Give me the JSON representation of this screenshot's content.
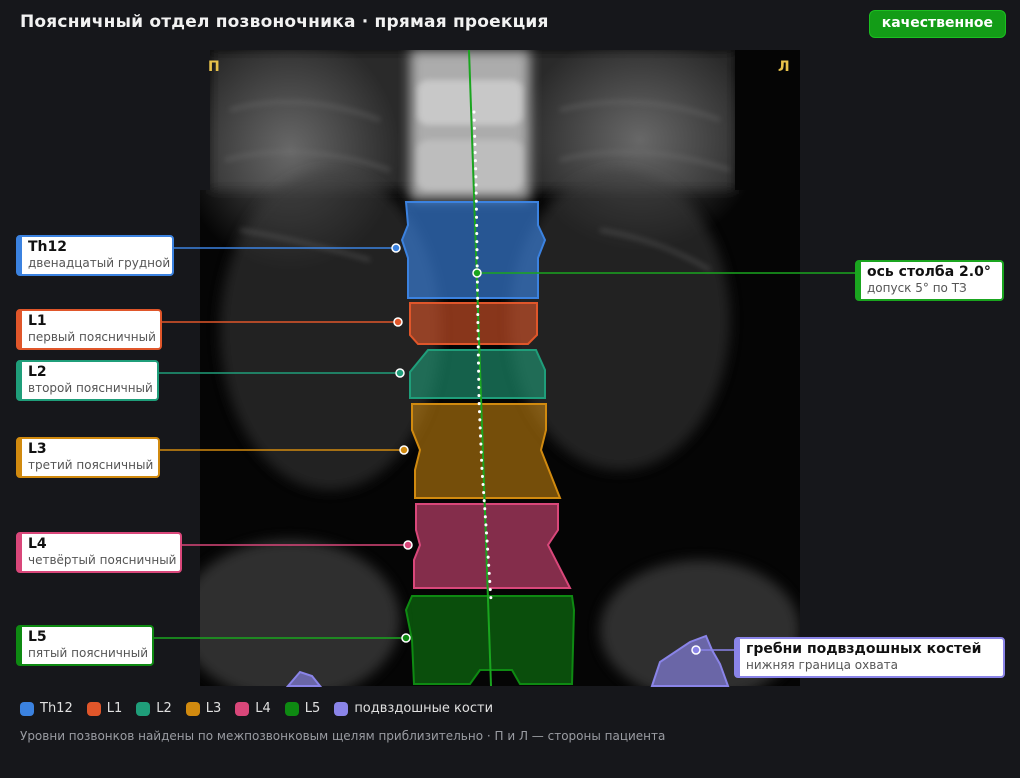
{
  "header": {
    "title": "Поясничный отдел позвоночника · прямая проекция",
    "badge": "качественное"
  },
  "image": {
    "side_left": "П",
    "side_right": "Л"
  },
  "vertebrae": [
    {
      "id": "th12",
      "name": "Th12",
      "desc": "двенадцатый грудной",
      "color": "#3b82e0"
    },
    {
      "id": "l1",
      "name": "L1",
      "desc": "первый поясничный",
      "color": "#e0562a"
    },
    {
      "id": "l2",
      "name": "L2",
      "desc": "второй поясничный",
      "color": "#1f9e7a"
    },
    {
      "id": "l3",
      "name": "L3",
      "desc": "третий поясничный",
      "color": "#d18a0f"
    },
    {
      "id": "l4",
      "name": "L4",
      "desc": "четвёртый поясничный",
      "color": "#d9477a"
    },
    {
      "id": "l5",
      "name": "L5",
      "desc": "пятый поясничный",
      "color": "#0e8a12"
    }
  ],
  "axis": {
    "title": "ось столба 2.0°",
    "note": "допуск 5° по ТЗ",
    "color": "#1aa51f"
  },
  "iliac": {
    "title": "гребни подвздошных костей",
    "note": "нижняя граница охвата",
    "color": "#8a84e8"
  },
  "legend": [
    {
      "label": "Th12",
      "color": "#3b82e0"
    },
    {
      "label": "L1",
      "color": "#e0562a"
    },
    {
      "label": "L2",
      "color": "#1f9e7a"
    },
    {
      "label": "L3",
      "color": "#d18a0f"
    },
    {
      "label": "L4",
      "color": "#d9477a"
    },
    {
      "label": "L5",
      "color": "#0e8a12"
    },
    {
      "label": "подвздошные кости",
      "color": "#8a84e8"
    }
  ],
  "footnote": "Уровни позвонков найдены по межпозвонковым щелям приблизительно · П и Л — стороны пациента"
}
